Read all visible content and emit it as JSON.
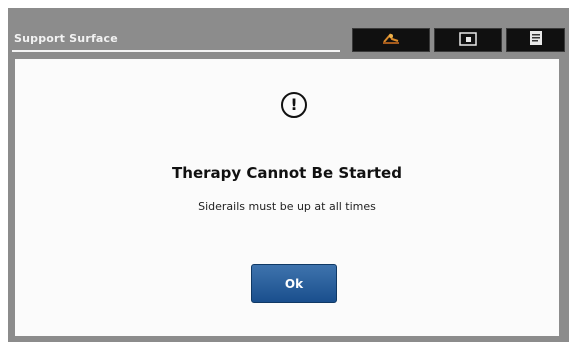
{
  "header": {
    "title": "Support Surface"
  },
  "tabs": [
    {
      "icon": "bed-therapy-icon"
    },
    {
      "icon": "mode-icon"
    },
    {
      "icon": "document-icon"
    }
  ],
  "dialog": {
    "icon": "warning-icon",
    "icon_glyph": "!",
    "title": "Therapy Cannot Be Started",
    "message": "Siderails must be up at all times",
    "ok_label": "Ok"
  },
  "colors": {
    "frame": "#8c8c8c",
    "tab_bg": "#101010",
    "accent": "#1a4f8d",
    "panel": "#fbfbfb"
  }
}
